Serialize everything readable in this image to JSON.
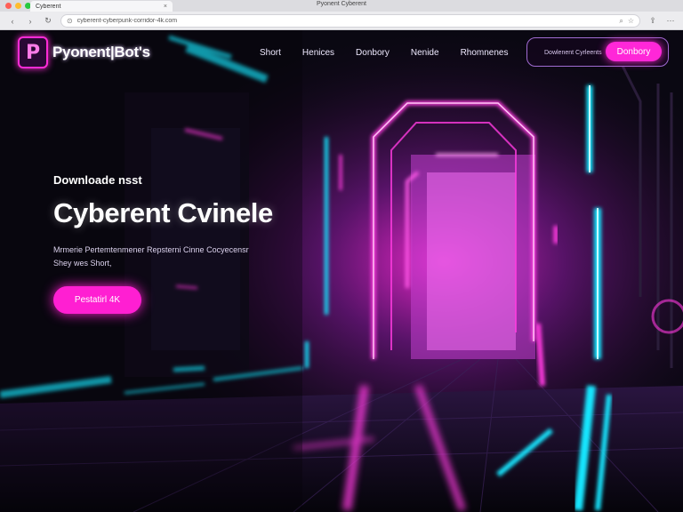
{
  "browser": {
    "tab_title": "Cyberent",
    "tab_close": "×",
    "window_title": "Pyonent Cyberent",
    "address": "cyberent-cyberpunk-corridor-4k.com",
    "back_icon": "‹",
    "forward_icon": "›",
    "reload_icon": "↻",
    "lock_icon": "⊙",
    "search_icon": "⌕",
    "share_icon": "⇪",
    "star_icon": "☆",
    "menu_icon": "⋯",
    "dot_colors": [
      "#ff5f57",
      "#febc2e",
      "#28c840"
    ]
  },
  "nav": {
    "logo_mark": "P",
    "logo_text": "Pyonent|Bot's",
    "links": [
      "Short",
      "Henices",
      "Donbory",
      "Nenide",
      "Rhomnenes"
    ],
    "cta_text": "Dowlenent Cyrleents",
    "cta_button": "Donbory"
  },
  "hero": {
    "kicker": "Downloade nsst",
    "title": "Cyberent Cvinele",
    "description_line1": "Mrmerie Pertemtenmener Repsterni Cinne Cocyecensr",
    "description_line2": "Shey wes Short,",
    "cta": "Pestatirl 4K"
  },
  "colors": {
    "accent_magenta": "#ff1fd2",
    "accent_cyan": "#19e6ff",
    "background": "#07060d"
  }
}
